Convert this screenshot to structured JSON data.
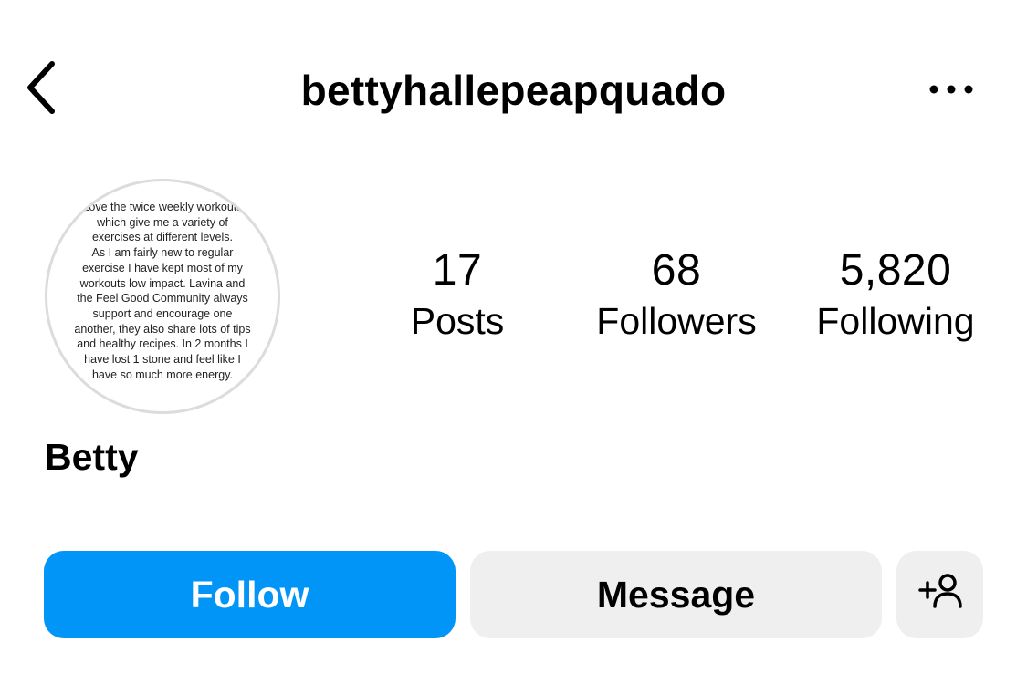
{
  "header": {
    "username": "bettyhallepeapquado",
    "back_icon": "chevron-left-icon",
    "more_icon": "more-horizontal-icon"
  },
  "profile": {
    "avatar_text": "Love the twice weekly workouts\nwhich give me a variety of\nexercises at different levels.\nAs I am fairly new to regular\nexercise I have kept most of my\nworkouts low impact. Lavina and\nthe Feel Good Community always\nsupport and encourage one\nanother, they also share lots of tips\nand healthy recipes. In 2 months I\nhave lost 1 stone and feel like I\nhave so much more energy.",
    "display_name": "Betty"
  },
  "stats": {
    "posts": {
      "value": "17",
      "label": "Posts"
    },
    "followers": {
      "value": "68",
      "label": "Followers"
    },
    "following": {
      "value": "5,820",
      "label": "Following"
    }
  },
  "actions": {
    "follow_label": "Follow",
    "message_label": "Message",
    "add_user_icon": "add-person-icon"
  },
  "colors": {
    "follow_bg": "#0095f6",
    "secondary_bg": "#efefef",
    "text": "#000000"
  }
}
